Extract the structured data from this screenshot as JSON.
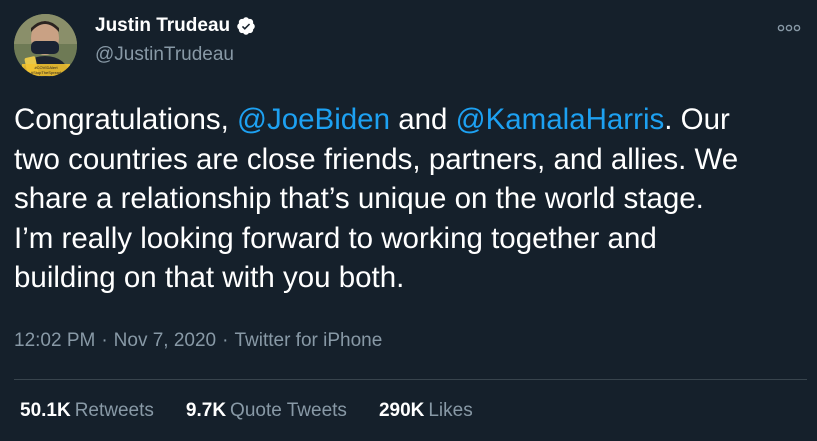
{
  "author": {
    "display_name": "Justin Trudeau",
    "handle": "@JustinTrudeau",
    "verified": true,
    "avatar_text": "#COVIDAlert #StopTheSpread"
  },
  "tweet": {
    "lines": [
      [
        {
          "text": "Congratulations, ",
          "mention": false
        },
        {
          "text": "@JoeBiden",
          "mention": true
        },
        {
          "text": " and ",
          "mention": false
        },
        {
          "text": "@KamalaHarris",
          "mention": true
        },
        {
          "text": ". Our",
          "mention": false
        }
      ],
      [
        {
          "text": "two countries are close friends, partners, and allies. We",
          "mention": false
        }
      ],
      [
        {
          "text": "share a relationship that’s unique on the world stage.",
          "mention": false
        }
      ],
      [
        {
          "text": "I’m really looking forward to working together and",
          "mention": false
        }
      ],
      [
        {
          "text": "building on that with you both.",
          "mention": false
        }
      ]
    ],
    "time": "12:02 PM",
    "date": "Nov 7, 2020",
    "source": "Twitter for iPhone",
    "separator": "·"
  },
  "stats": [
    {
      "value": "50.1K",
      "label": "Retweets",
      "name": "retweets-stat"
    },
    {
      "value": "9.7K",
      "label": "Quote Tweets",
      "name": "quote-tweets-stat"
    },
    {
      "value": "290K",
      "label": "Likes",
      "name": "likes-stat"
    }
  ],
  "colors": {
    "background": "#15202b",
    "mention": "#1da1f2",
    "secondary_text": "#8899a6",
    "divider": "#38444d"
  },
  "icons": {
    "verified": "verified-badge-icon",
    "more": "more-options-icon"
  }
}
